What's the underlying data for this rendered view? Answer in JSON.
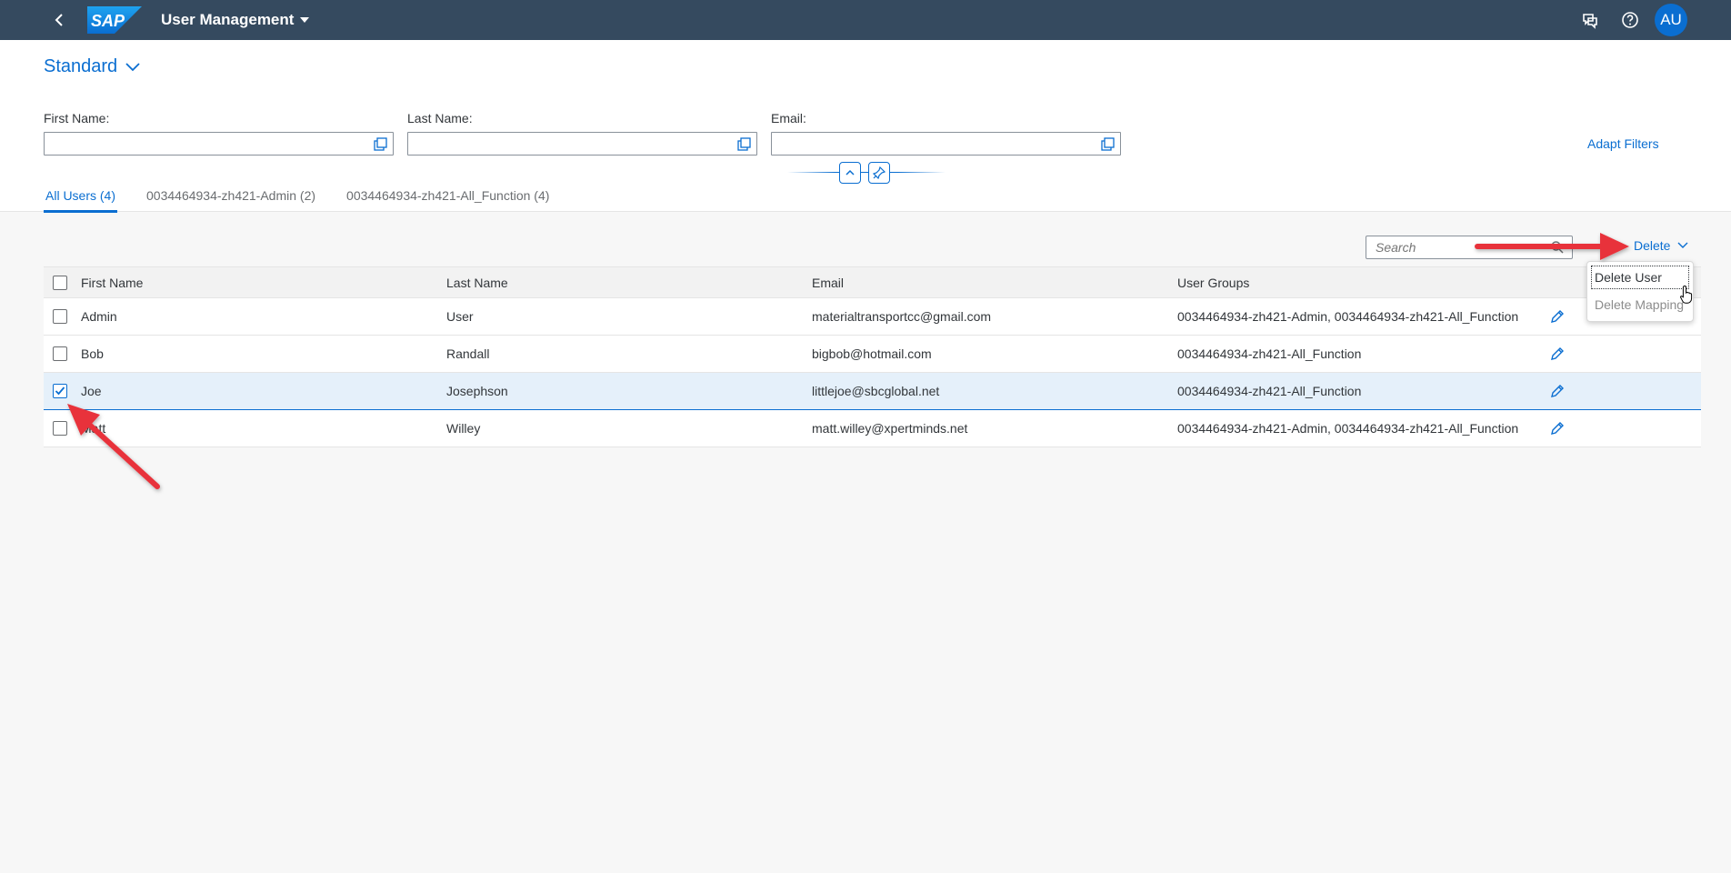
{
  "shell": {
    "logo_text": "SAP",
    "app_title": "User Management",
    "avatar_initials": "AU",
    "icons": [
      "back-icon",
      "chevron-down-icon",
      "feedback-icon",
      "help-icon"
    ]
  },
  "header": {
    "variant": "Standard",
    "filters": {
      "first_name_label": "First Name:",
      "last_name_label": "Last Name:",
      "email_label": "Email:"
    },
    "adapt_filters": "Adapt Filters",
    "tabs": [
      {
        "label": "All Users (4)",
        "active": true
      },
      {
        "label": "0034464934-zh421-Admin (2)",
        "active": false
      },
      {
        "label": "0034464934-zh421-All_Function (4)",
        "active": false
      }
    ]
  },
  "toolbar": {
    "search_placeholder": "Search",
    "delete_label": "Delete"
  },
  "table": {
    "columns": [
      "First Name",
      "Last Name",
      "Email",
      "User Groups"
    ],
    "rows": [
      {
        "first": "Admin",
        "last": "User",
        "email": "materialtransportcc@gmail.com",
        "groups": "0034464934-zh421-Admin, 0034464934-zh421-All_Function",
        "checked": false
      },
      {
        "first": "Bob",
        "last": "Randall",
        "email": "bigbob@hotmail.com",
        "groups": "0034464934-zh421-All_Function",
        "checked": false
      },
      {
        "first": "Joe",
        "last": "Josephson",
        "email": "littlejoe@sbcglobal.net",
        "groups": "0034464934-zh421-All_Function",
        "checked": true
      },
      {
        "first": "Matt",
        "last": "Willey",
        "email": "matt.willey@xpertminds.net",
        "groups": "0034464934-zh421-Admin, 0034464934-zh421-All_Function",
        "checked": false
      }
    ]
  },
  "delete_menu": {
    "items": [
      {
        "label": "Delete User",
        "enabled": true
      },
      {
        "label": "Delete Mapping",
        "enabled": false
      }
    ]
  },
  "colors": {
    "shell_bg": "#354a5f",
    "accent": "#0a6ed1",
    "selected_row": "#e5f0fa",
    "annotation_arrow": "#e8333a"
  }
}
